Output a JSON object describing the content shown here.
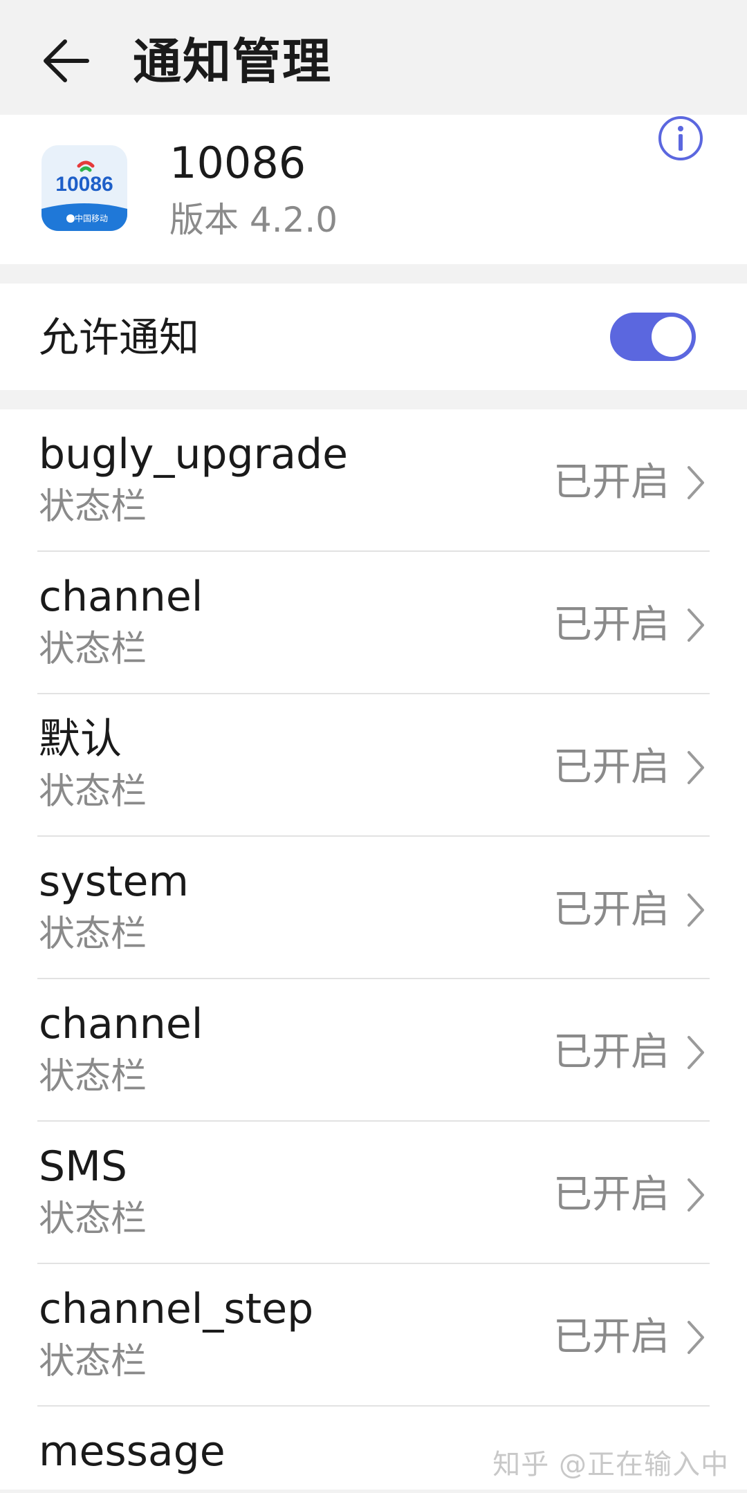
{
  "header": {
    "title": "通知管理",
    "back_icon": "arrow-left-icon"
  },
  "app": {
    "name": "10086",
    "version": "版本 4.2.0",
    "icon": "china-mobile-10086-app-icon",
    "icon_label": "10086",
    "icon_sublabel": "中国移动",
    "info_icon": "info-circle-icon"
  },
  "allow_notifications": {
    "label": "允许通知",
    "enabled": true
  },
  "channels": [
    {
      "title": "bugly_upgrade",
      "subtitle": "状态栏",
      "status": "已开启"
    },
    {
      "title": "channel",
      "subtitle": "状态栏",
      "status": "已开启"
    },
    {
      "title": "默认",
      "subtitle": "状态栏",
      "status": "已开启"
    },
    {
      "title": "system",
      "subtitle": "状态栏",
      "status": "已开启"
    },
    {
      "title": "channel",
      "subtitle": "状态栏",
      "status": "已开启"
    },
    {
      "title": "SMS",
      "subtitle": "状态栏",
      "status": "已开启"
    },
    {
      "title": "channel_step",
      "subtitle": "状态栏",
      "status": "已开启"
    },
    {
      "title": "message",
      "subtitle": "",
      "status": ""
    }
  ],
  "watermark": "知乎 @正在输入中",
  "colors": {
    "accent": "#5b67df",
    "background": "#f2f2f2",
    "card": "#ffffff",
    "secondary_text": "#8a8a8a"
  }
}
